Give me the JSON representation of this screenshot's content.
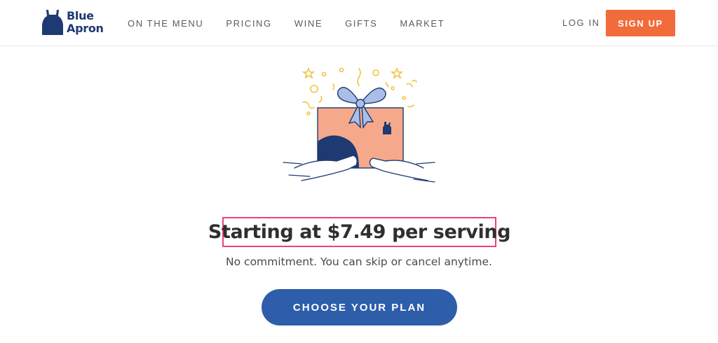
{
  "brand": {
    "logo_line1": "Blue",
    "logo_line2": "Apron",
    "color": "#1f3a72"
  },
  "nav": {
    "items": [
      {
        "label": "ON THE MENU"
      },
      {
        "label": "PRICING"
      },
      {
        "label": "WINE"
      },
      {
        "label": "GIFTS"
      },
      {
        "label": "MARKET"
      }
    ]
  },
  "auth": {
    "login_label": "LOG IN",
    "signup_label": "SIGN UP",
    "signup_color": "#f26b3a"
  },
  "hero": {
    "illustration": "gift-box-icon",
    "headline": "Starting at $7.49 per serving",
    "subtext": "No commitment. You can skip or cancel anytime.",
    "cta_label": "CHOOSE YOUR PLAN",
    "cta_color": "#2e5daa",
    "highlight_color": "#e8437f"
  }
}
